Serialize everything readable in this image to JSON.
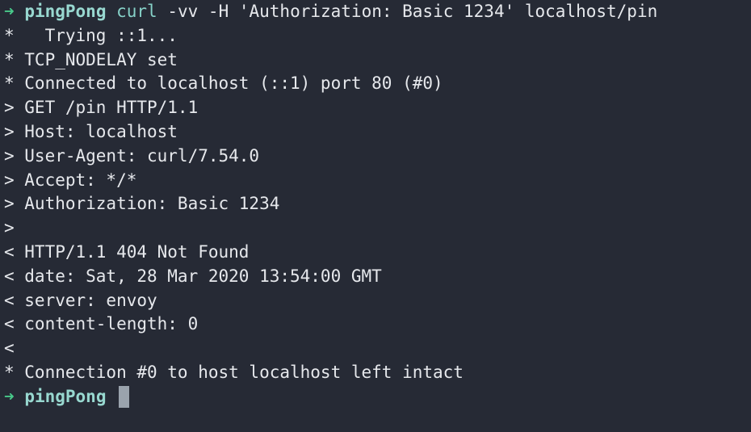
{
  "prompt": {
    "arrow_glyph": "➜",
    "directory": "pingPong"
  },
  "command": {
    "program": "curl",
    "args": "-vv -H 'Authorization: Basic 1234' localhost/pin"
  },
  "output_lines": [
    "*   Trying ::1...",
    "* TCP_NODELAY set",
    "* Connected to localhost (::1) port 80 (#0)",
    "> GET /pin HTTP/1.1",
    "> Host: localhost",
    "> User-Agent: curl/7.54.0",
    "> Accept: */*",
    "> Authorization: Basic 1234",
    ">",
    "< HTTP/1.1 404 Not Found",
    "< date: Sat, 28 Mar 2020 13:54:00 GMT",
    "< server: envoy",
    "< content-length: 0",
    "<",
    "* Connection #0 to host localhost left intact"
  ],
  "colors": {
    "background": "#262a35",
    "prompt_arrow": "#48c98a",
    "prompt_dir": "#98d8d0",
    "command": "#86d1c8",
    "output": "#e6e8ec",
    "cursor": "#9aa3ad"
  }
}
